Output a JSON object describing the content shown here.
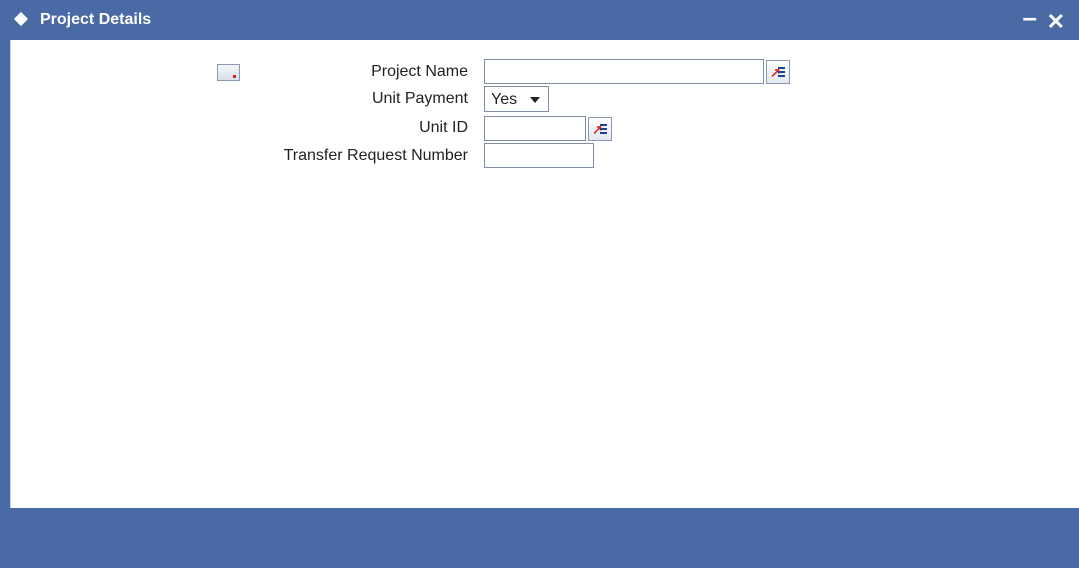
{
  "window": {
    "title": "Project Details",
    "minimize_label": "–",
    "close_label": "✕"
  },
  "form": {
    "project_name": {
      "label": "Project Name",
      "value": ""
    },
    "unit_payment": {
      "label": "Unit Payment",
      "selected": "Yes"
    },
    "unit_id": {
      "label": "Unit ID",
      "value": ""
    },
    "transfer_request_number": {
      "label": "Transfer Request Number",
      "value": ""
    }
  },
  "icons": {
    "title": "diamond-icon",
    "doc": "document-icon",
    "lov": "list-of-values-icon"
  },
  "colors": {
    "titlebar": "#4a6aa6",
    "footer": "#4a6aa6",
    "lov_arrow": "#d62a1a"
  }
}
